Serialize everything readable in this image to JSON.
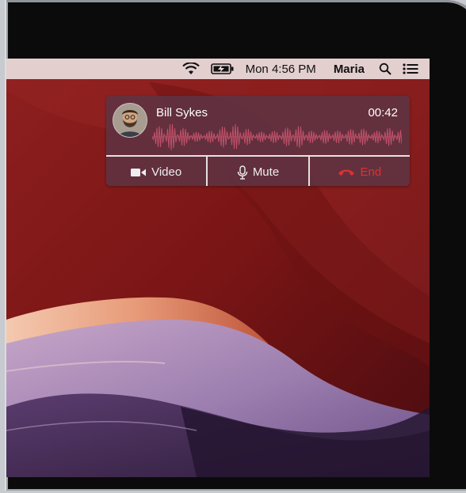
{
  "menubar": {
    "clock": "Mon 4:56 PM",
    "user": "Maria",
    "icons": [
      "wifi-icon",
      "battery-charging-icon",
      "spotlight-search-icon",
      "notification-center-icon"
    ]
  },
  "call": {
    "caller_name": "Bill Sykes",
    "duration": "00:42",
    "actions": {
      "video_label": "Video",
      "mute_label": "Mute",
      "end_label": "End"
    }
  },
  "colors": {
    "end_red": "#e03030",
    "waveform": "#c2506a",
    "notification_bg": "#5c3446"
  }
}
